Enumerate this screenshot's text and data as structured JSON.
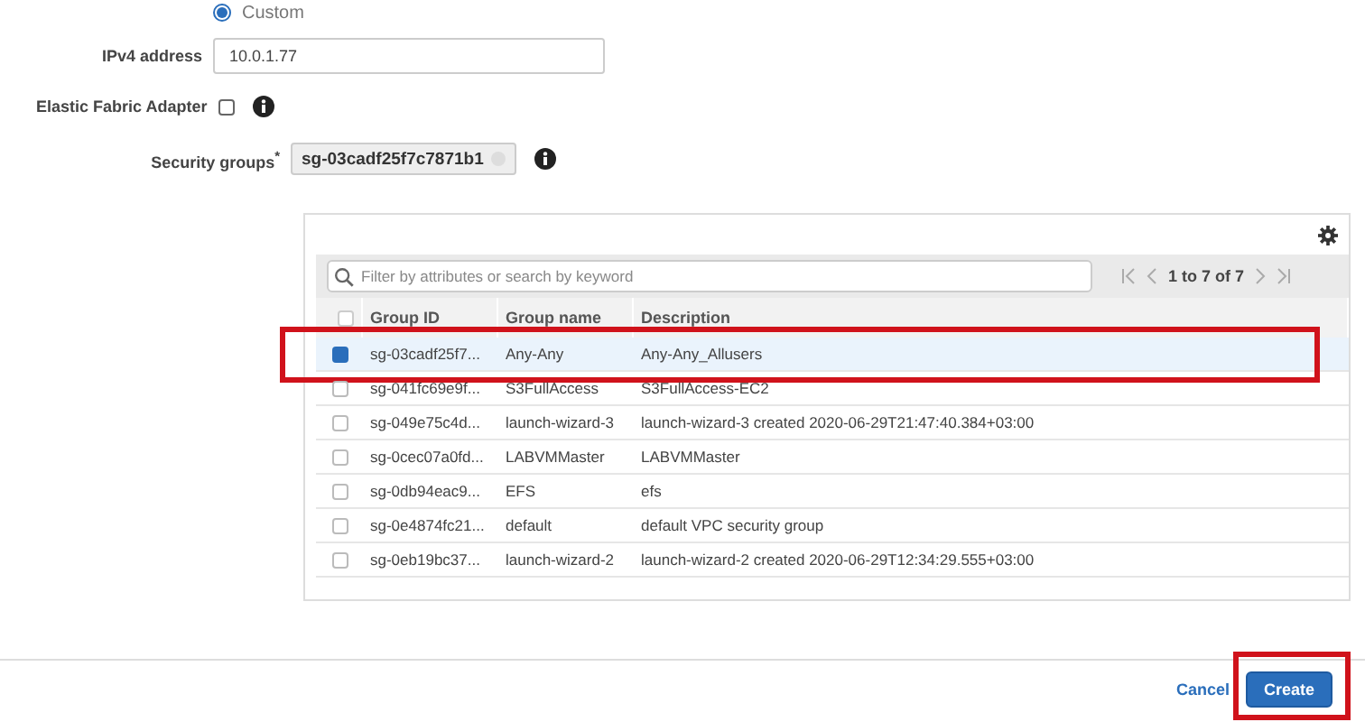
{
  "assign_option": {
    "label": "Custom",
    "selected": true
  },
  "ipv4": {
    "label": "IPv4 address",
    "value": "10.0.1.77"
  },
  "efa": {
    "label": "Elastic Fabric Adapter",
    "checked": false
  },
  "security_groups": {
    "label": "Security groups",
    "required_mark": "*",
    "token": "sg-03cadf25f7c7871b1"
  },
  "table": {
    "search": {
      "placeholder": "Filter by attributes or search by keyword"
    },
    "pagination": "1 to 7 of 7",
    "columns": [
      "Group ID",
      "Group name",
      "Description"
    ],
    "all_selected": false,
    "rows": [
      {
        "id": "sg-03cadf25f7...",
        "name": "Any-Any",
        "description": "Any-Any_Allusers",
        "selected": true
      },
      {
        "id": "sg-041fc69e9f...",
        "name": "S3FullAccess",
        "description": "S3FullAccess-EC2",
        "selected": false
      },
      {
        "id": "sg-049e75c4d...",
        "name": "launch-wizard-3",
        "description": "launch-wizard-3 created 2020-06-29T21:47:40.384+03:00",
        "selected": false
      },
      {
        "id": "sg-0cec07a0fd...",
        "name": "LABVMMaster",
        "description": "LABVMMaster",
        "selected": false
      },
      {
        "id": "sg-0db94eac9...",
        "name": "EFS",
        "description": "efs",
        "selected": false
      },
      {
        "id": "sg-0e4874fc21...",
        "name": "default",
        "description": "default VPC security group",
        "selected": false
      },
      {
        "id": "sg-0eb19bc37...",
        "name": "launch-wizard-2",
        "description": "launch-wizard-2 created 2020-06-29T12:34:29.555+03:00",
        "selected": false
      }
    ]
  },
  "buttons": {
    "cancel": "Cancel",
    "create": "Create"
  }
}
